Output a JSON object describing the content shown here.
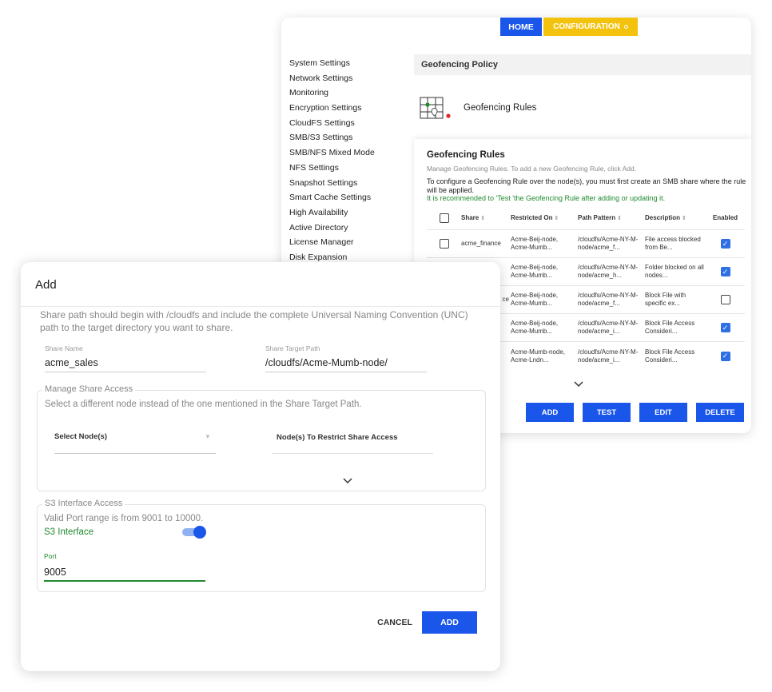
{
  "nav": {
    "home_label": "HOME",
    "config_label": "CONFIGURATION"
  },
  "sidebar": {
    "items": [
      "System Settings",
      "Network Settings",
      "Monitoring",
      "Encryption Settings",
      "CloudFS Settings",
      "SMB/S3 Settings",
      "SMB/NFS Mixed Mode",
      "NFS Settings",
      "Snapshot Settings",
      "Smart Cache Settings",
      "High Availability",
      "Active Directory",
      "License Manager",
      "Disk Expansion"
    ]
  },
  "policy": {
    "title": "Geofencing Policy",
    "rules_label": "Geofencing Rules"
  },
  "rules_panel": {
    "title": "Geofencing Rules",
    "subtitle": "Manage Geofencing Rules. To add a new Geofencing Rule, click Add.",
    "info": "To configure a Geofencing Rule over the node(s), you must first create an SMB share where the rule will be applied.",
    "warning": "It is recommended to 'Test 'the Geofencing Rule after adding or updating it.",
    "columns": {
      "share": "Share",
      "restricted_on": "Restricted On",
      "path_pattern": "Path Pattern",
      "description": "Description",
      "enabled": "Enabled"
    },
    "rows": [
      {
        "share": "acme_finance",
        "restricted": "Acme-Beij-node, Acme-Mumb...",
        "path": "/cloudfs/Acme-NY-M-node/acme_f...",
        "desc": "File access blocked from Be...",
        "enabled": true
      },
      {
        "share": "",
        "restricted": "Acme-Beij-node, Acme-Mumb...",
        "path": "/cloudfs/Acme-NY-M-node/acme_h...",
        "desc": "Folder blocked on all nodes...",
        "enabled": true
      },
      {
        "share": "ce",
        "restricted": "Acme-Beij-node, Acme-Mumb...",
        "path": "/cloudfs/Acme-NY-M-node/acme_f...",
        "desc": "Block File with specific ex...",
        "enabled": false
      },
      {
        "share": "",
        "restricted": "Acme-Beij-node, Acme-Mumb...",
        "path": "/cloudfs/Acme-NY-M-node/acme_i...",
        "desc": "Block File Access Consideri...",
        "enabled": true
      },
      {
        "share": "",
        "restricted": "Acme-Mumb-node, Acme-Lndn...",
        "path": "/cloudfs/Acme-NY-M-node/acme_i...",
        "desc": "Block File Access Consideri...",
        "enabled": true
      }
    ],
    "buttons": {
      "add": "ADD",
      "test": "TEST",
      "edit": "EDIT",
      "delete": "DELETE"
    }
  },
  "dialog": {
    "title": "Add",
    "note": "Share path should begin with /cloudfs and include the complete Universal Naming Convention (UNC) path to the target directory you want to share.",
    "share_name": {
      "label": "Share Name",
      "value": "acme_sales"
    },
    "share_target": {
      "label": "Share Target Path",
      "value": "/cloudfs/Acme-Mumb-node/"
    },
    "manage_access": {
      "legend": "Manage Share Access",
      "desc": "Select a different node instead of the one mentioned in the Share Target Path.",
      "select_nodes": "Select Node(s)",
      "restrict_nodes": "Node(s) To Restrict Share Access"
    },
    "s3": {
      "legend": "S3 Interface Access",
      "desc": "Valid Port range is from 9001 to 10000.",
      "interface_label": "S3 Interface",
      "interface_enabled": true,
      "port_label": "Port",
      "port_value": "9005"
    },
    "cancel_label": "CANCEL",
    "add_label": "ADD"
  },
  "colors": {
    "primary": "#1a56ea",
    "accent_yellow": "#f3c20d",
    "success_green": "#1f8a2e"
  }
}
